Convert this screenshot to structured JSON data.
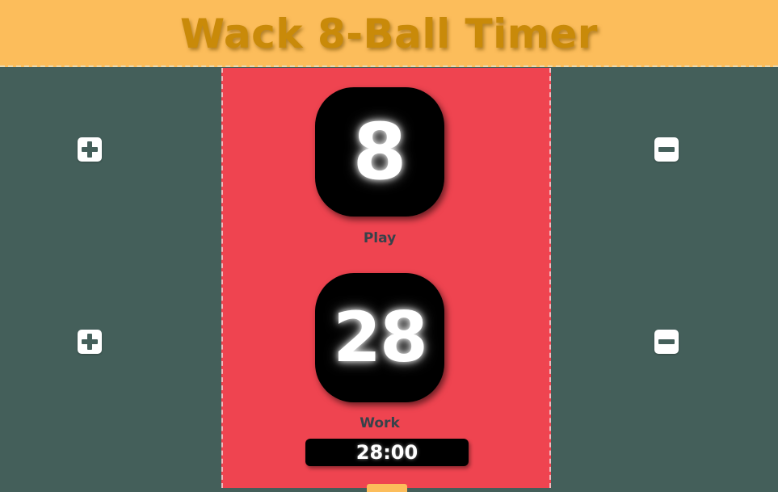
{
  "header": {
    "title": "Wack 8-Ball Timer"
  },
  "play": {
    "count": "8",
    "label": "Play"
  },
  "work": {
    "count": "28",
    "label": "Work"
  },
  "clock": {
    "time": "28:00"
  },
  "icons": {
    "increment": "plus-icon",
    "decrement": "minus-icon"
  },
  "colors": {
    "header_bg": "#fcbd5b",
    "title_text": "#c98a09",
    "side_bg": "#445f5a",
    "center_bg": "#ef4450",
    "counter_bg": "#000000",
    "button_bg": "#ffffff"
  }
}
